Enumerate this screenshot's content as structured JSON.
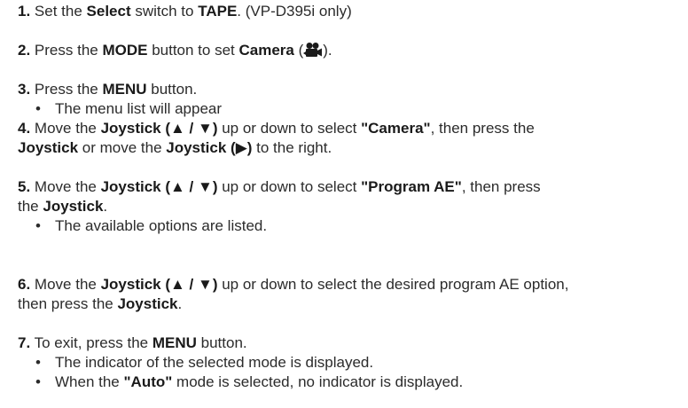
{
  "steps": [
    {
      "num": "1.",
      "parts": [
        "Set the ",
        "Select",
        " switch to ",
        "TAPE",
        ". (VP-D395i only)"
      ]
    },
    {
      "num": "2.",
      "parts": [
        "Press the ",
        "MODE",
        " button to set ",
        "Camera",
        " (",
        ")."
      ],
      "icon": "movie-camera-icon"
    },
    {
      "num": "3.",
      "parts": [
        "Press the ",
        "MENU",
        " button."
      ],
      "bullets": [
        "The menu list will appear"
      ]
    },
    {
      "num": "4.",
      "parts": [
        "Move the ",
        "Joystick (▲ / ▼)",
        " up or down to select ",
        "\"Camera\"",
        ", then press the"
      ],
      "parts2": [
        "Joystick",
        " or move the ",
        "Joystick (▶)",
        " to the right."
      ]
    },
    {
      "num": "5.",
      "parts": [
        "Move the ",
        "Joystick (▲ / ▼)",
        " up or down to select ",
        "\"Program AE\"",
        ", then press"
      ],
      "parts2": [
        "the ",
        "Joystick",
        "."
      ],
      "bullets": [
        "The available options are listed."
      ]
    },
    {
      "num": "6.",
      "parts": [
        "Move the ",
        "Joystick (▲ / ▼)",
        " up or down to select the desired program AE option,"
      ],
      "parts2": [
        "then press the ",
        "Joystick",
        "."
      ]
    },
    {
      "num": "7.",
      "parts": [
        "To exit, press the ",
        "MENU",
        " button."
      ],
      "bullets": [
        "The indicator of the selected mode is displayed.",
        "When the "
      ],
      "bullet2_bold": "\"Auto\"",
      "bullet2_rest": " mode is selected, no indicator is displayed."
    }
  ],
  "bullet_char": "•"
}
